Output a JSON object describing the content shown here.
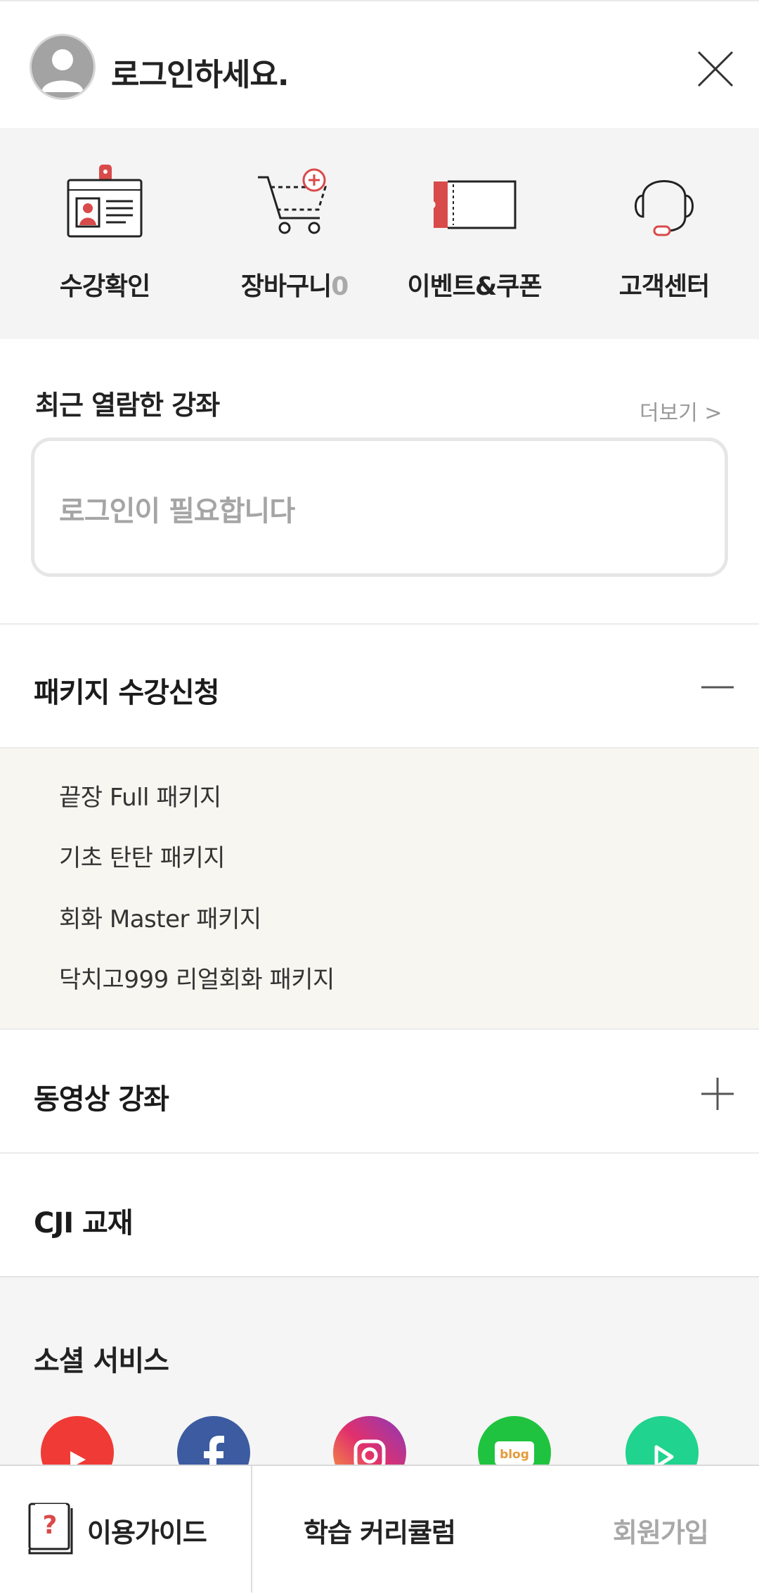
{
  "header": {
    "title": "로그인하세요."
  },
  "quick_menu": [
    {
      "label": "수강확인",
      "icon": "id-card-icon"
    },
    {
      "label": "장바구니",
      "count": "0",
      "icon": "cart-icon"
    },
    {
      "label": "이벤트&쿠폰",
      "icon": "ticket-icon"
    },
    {
      "label": "고객센터",
      "icon": "headset-icon"
    }
  ],
  "recent": {
    "title": "최근 열람한 강좌",
    "more": "더보기 >",
    "empty_text": "로그인이 필요합니다"
  },
  "menu": {
    "package": {
      "title": "패키지 수강신청",
      "items": [
        "끝장 Full 패키지",
        "기초 탄탄 패키지",
        "회화 Master 패키지",
        "닥치고999 리얼회화 패키지"
      ]
    },
    "video": {
      "title": "동영상 강좌"
    },
    "book": {
      "title": "CJI 교재"
    }
  },
  "social": {
    "title": "소셜 서비스",
    "links": [
      "youtube-icon",
      "facebook-icon",
      "instagram-icon",
      "blog-icon",
      "play-icon"
    ],
    "blog_text": "blog"
  },
  "bottom_bar": {
    "guide": "이용가이드",
    "curriculum": "학습 커리큘럼",
    "join": "회원가입"
  },
  "colors": {
    "accent_red": "#d94a4a",
    "sub_panel_bg": "#f8f6f0",
    "quick_bg": "#f4f4f4"
  }
}
